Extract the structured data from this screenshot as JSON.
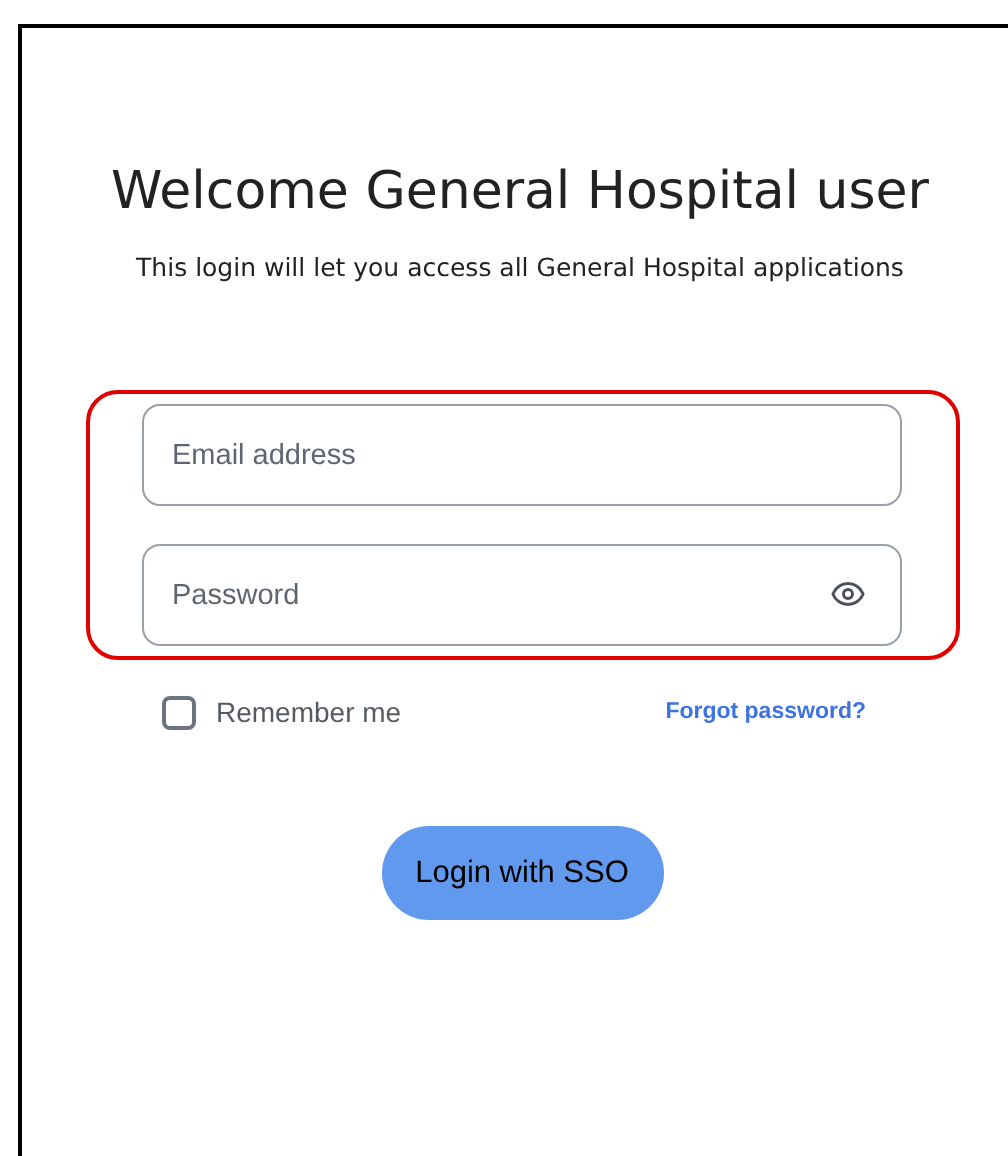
{
  "title": "Welcome General Hospital user",
  "subtitle": "This login will let you access all General Hospital applications",
  "fields": [
    {
      "kind": "email",
      "placeholder": "Email address"
    },
    {
      "kind": "password",
      "placeholder": "Password"
    }
  ],
  "remember": {
    "label": "Remember me",
    "checked": false
  },
  "forgot_link": "Forgot password?",
  "submit_button": "Login with SSO"
}
